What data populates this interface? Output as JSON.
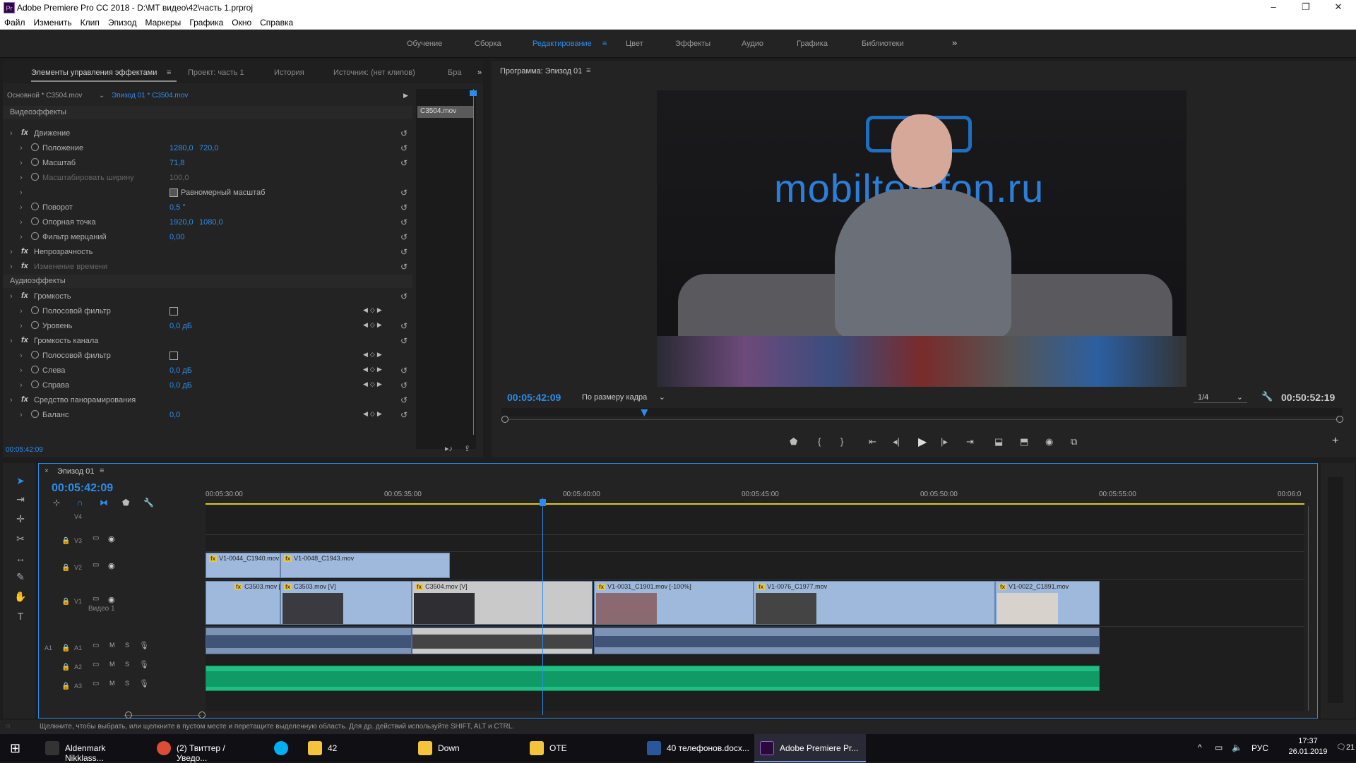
{
  "window": {
    "title": "Adobe Premiere Pro CC 2018 - D:\\MT видео\\42\\часть 1.prproj",
    "logo": "Pr",
    "minimize": "–",
    "maximize": "❐",
    "close": "✕"
  },
  "menu": [
    "Файл",
    "Изменить",
    "Клип",
    "Эпизод",
    "Маркеры",
    "Графика",
    "Окно",
    "Справка"
  ],
  "workspaces": [
    "Обучение",
    "Сборка",
    "Редактирование",
    "Цвет",
    "Эффекты",
    "Аудио",
    "Графика",
    "Библиотеки"
  ],
  "active_workspace": "Редактирование",
  "effect_panel": {
    "tabs": [
      "Элементы управления эффектами",
      "Проект: часть 1",
      "История",
      "Источник: (нет клипов)",
      "Бра"
    ],
    "source_label": "Основной * C3504.mov",
    "sequence_label": "Эпизод 01 * C3504.mov",
    "clip_label": "C3504.mov",
    "video_header": "Видеоэффекты",
    "audio_header": "Аудиоэффекты",
    "time": "00:05:42:09",
    "rows": [
      {
        "label": "Движение",
        "fx": true,
        "v1": "",
        "v2": ""
      },
      {
        "label": "Положение",
        "v1": "1280,0",
        "v2": "720,0"
      },
      {
        "label": "Масштаб",
        "v1": "71,8",
        "v2": ""
      },
      {
        "label": "Масштабировать ширину",
        "v1": "100,0",
        "v2": "",
        "dim": true
      },
      {
        "label": "Равномерный масштаб",
        "check": true
      },
      {
        "label": "Поворот",
        "v1": "0,5 °",
        "v2": ""
      },
      {
        "label": "Опорная точка",
        "v1": "1920,0",
        "v2": "1080,0"
      },
      {
        "label": "Фильтр мерцаний",
        "v1": "0,00",
        "v2": ""
      },
      {
        "label": "Непрозрачность",
        "fx": true
      },
      {
        "label": "Изменение времени",
        "fx": true,
        "dim": true
      },
      {
        "label": "Громкость",
        "fx": true
      },
      {
        "label": "Полосовой фильтр",
        "box": true
      },
      {
        "label": "Уровень",
        "v1": "0,0 дБ"
      },
      {
        "label": "Громкость канала",
        "fx": true
      },
      {
        "label": "Полосовой фильтр",
        "box": true
      },
      {
        "label": "Слева",
        "v1": "0,0 дБ"
      },
      {
        "label": "Справа",
        "v1": "0,0 дБ"
      },
      {
        "label": "Средство панорамирования",
        "fx": true
      },
      {
        "label": "Баланс",
        "v1": "0,0"
      }
    ]
  },
  "program": {
    "title": "Программа: Эпизод 01",
    "timecode": "00:05:42:09",
    "fit": "По размеру кадра",
    "quality": "1/4",
    "duration": "00:50:52:19",
    "video_caption": "mobiltelefon.ru",
    "playhead": 0.17
  },
  "timeline": {
    "tab": "Эпизод 01",
    "timecode": "00:05:42:09",
    "ruler": [
      "00:05:30:00",
      "00:05:35:00",
      "00:05:40:00",
      "00:05:45:00",
      "00:05:50:00",
      "00:05:55:00",
      "00:06:0"
    ],
    "tracks": [
      "V4",
      "V3",
      "V2",
      "V1",
      "A1",
      "A2",
      "A3"
    ],
    "v1_name": "Видео 1",
    "v2_clips": [
      {
        "name": "V1-0044_C1940.mov"
      },
      {
        "name": "V1-0048_C1943.mov"
      }
    ],
    "v1_clips": [
      {
        "name": "C3503.mov [V]"
      },
      {
        "name": "C3503.mov [V]"
      },
      {
        "name": "C3504.mov [V]"
      },
      {
        "name": "V1-0031_C1901.mov [-100%]"
      },
      {
        "name": "V1-0076_C1977.mov"
      },
      {
        "name": "V1-0022_C1891.mov"
      }
    ],
    "status": "Щелкните, чтобы выбрать, или щелкните в пустом месте и перетащите выделенную область. Для др. действий используйте SHIFT, ALT и CTRL."
  },
  "taskbar": {
    "items": [
      "Aldenmark Nikklass...",
      "(2) Твиттер / Уведо...",
      "",
      "42",
      "Down",
      "OTE",
      "40 телефонов.docx...",
      "Adobe Premiere Pr..."
    ],
    "lang": "РУС",
    "time": "17:37",
    "date": "26.01.2019",
    "notif": "21"
  },
  "colors": {
    "accent": "#2d8ceb",
    "clip_video": "#9fb9dd",
    "clip_audio_a3": "#1fbf83"
  }
}
